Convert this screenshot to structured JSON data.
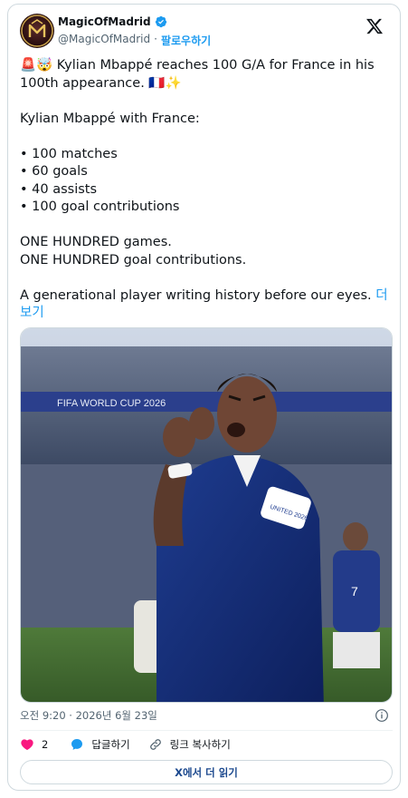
{
  "author": {
    "display_name": "MagicOfMadrid",
    "handle": "@MagicOfMadrid",
    "follow_label": "팔로우하기",
    "separator": "·",
    "verified_color": "#1d9bf0"
  },
  "tweet": {
    "lines": [
      "🚨🤯 Kylian Mbappé reaches 100 G/A for France in his 100th appearance. 🇫🇷✨",
      "",
      "Kylian Mbappé with France:",
      "",
      "• 100 matches",
      "• 60 goals",
      "• 40 assists",
      "• 100 goal contributions",
      "",
      "ONE HUNDRED games.",
      "ONE HUNDRED goal contributions.",
      "",
      "A generational player writing history before our eyes."
    ],
    "more_label": "더 보기"
  },
  "media": {
    "banner_text": "FIFA WORLD CUP 2026",
    "sleeve_text": "UNITED 2026",
    "jersey_number": "7"
  },
  "meta": {
    "timestamp": "오전 9:20 · 2026년 6월 23일"
  },
  "actions": {
    "like_count": "2",
    "reply_label": "답글하기",
    "copy_link_label": "링크 복사하기"
  },
  "read_more_label": "X에서 더 읽기",
  "colors": {
    "accent": "#1d9bf0",
    "like": "#f91880",
    "border": "#cfd9de"
  }
}
